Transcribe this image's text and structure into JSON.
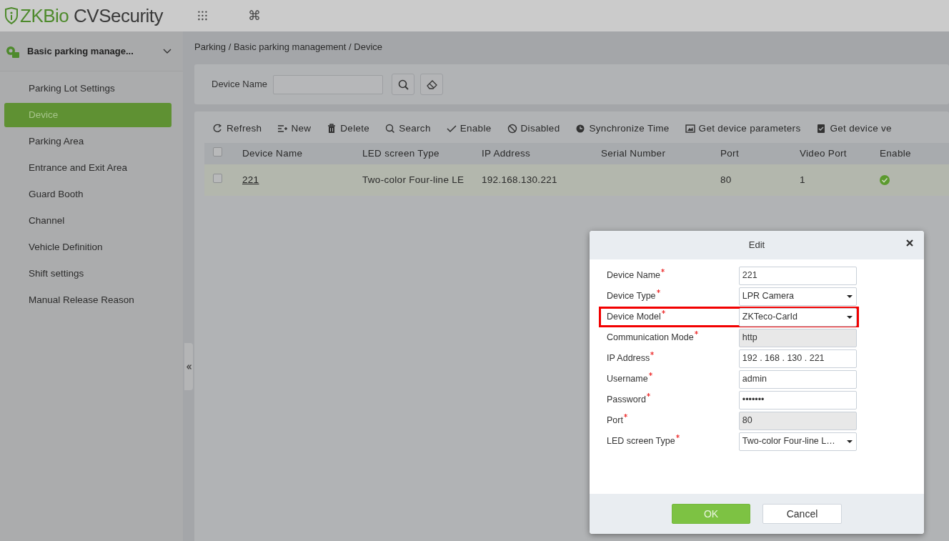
{
  "app": {
    "logo_text": "ZKBio",
    "logo_text2": " CVSecurity",
    "header_icons": [
      {
        "glyph": "⁝⁝⁝"
      },
      {
        "glyph": "⌘"
      }
    ]
  },
  "sidebar": {
    "group": {
      "label": "Basic parking manage...",
      "expanded": true
    },
    "items": [
      {
        "label": "Parking Lot Settings",
        "selected": false
      },
      {
        "label": "Device",
        "selected": true
      },
      {
        "label": "Parking Area",
        "selected": false
      },
      {
        "label": "Entrance and Exit Area",
        "selected": false
      },
      {
        "label": "Guard Booth",
        "selected": false
      },
      {
        "label": "Channel",
        "selected": false
      },
      {
        "label": "Vehicle Definition",
        "selected": false
      },
      {
        "label": "Shift settings",
        "selected": false
      },
      {
        "label": "Manual Release Reason",
        "selected": false
      }
    ]
  },
  "breadcrumb": "Parking / Basic parking management / Device",
  "search": {
    "label": "Device Name"
  },
  "toolbar": [
    {
      "label": "Refresh",
      "kind": "refresh"
    },
    {
      "label": "New",
      "kind": "new"
    },
    {
      "label": "Delete",
      "kind": "delete"
    },
    {
      "label": "Search",
      "kind": "search"
    },
    {
      "label": "Enable",
      "kind": "enable"
    },
    {
      "label": "Disabled",
      "kind": "disable"
    },
    {
      "label": "Synchronize Time",
      "kind": "sync"
    },
    {
      "label": "Get device parameters",
      "kind": "params"
    },
    {
      "label": "Get device ve",
      "kind": "version"
    }
  ],
  "table": {
    "columns": [
      "Device Name",
      "LED screen Type",
      "IP Address",
      "Serial Number",
      "Port",
      "Video Port",
      "Enable"
    ],
    "all_checked": false,
    "rows": [
      {
        "checked": false,
        "device_name": "221",
        "led_screen_type": "Two-color Four-line LE",
        "ip_address": "192.168.130.221",
        "port": "80",
        "video_port": "1",
        "enabled": true
      }
    ]
  },
  "dialog": {
    "title": "Edit",
    "fields": [
      {
        "label": "Device Name",
        "kind": "text",
        "value": "221",
        "required": true,
        "highlighted": false
      },
      {
        "label": "Device Type",
        "kind": "select",
        "value": "LPR Camera",
        "required": true,
        "highlighted": false
      },
      {
        "label": "Device Model",
        "kind": "select",
        "value": "ZKTeco-CarId",
        "required": true,
        "highlighted": true
      },
      {
        "label": "Communication Mode",
        "kind": "readonly",
        "value": "http",
        "required": true,
        "highlighted": false
      },
      {
        "label": "IP Address",
        "kind": "ip",
        "parts": [
          "192",
          ". 168",
          ". 130",
          ". 221"
        ],
        "required": true,
        "highlighted": false
      },
      {
        "label": "Username",
        "kind": "text",
        "value": "admin",
        "required": true,
        "highlighted": false
      },
      {
        "label": "Password",
        "kind": "text",
        "value": "•••••••",
        "required": true,
        "highlighted": false
      },
      {
        "label": "Port",
        "kind": "readonly",
        "value": "80",
        "required": true,
        "highlighted": false
      },
      {
        "label": "LED screen Type",
        "kind": "select",
        "value": "Two-color Four-line L…",
        "required": true,
        "highlighted": false
      }
    ],
    "buttons": [
      {
        "label": "OK",
        "kind": "primary"
      },
      {
        "label": "Cancel",
        "kind": "secondary"
      }
    ]
  }
}
